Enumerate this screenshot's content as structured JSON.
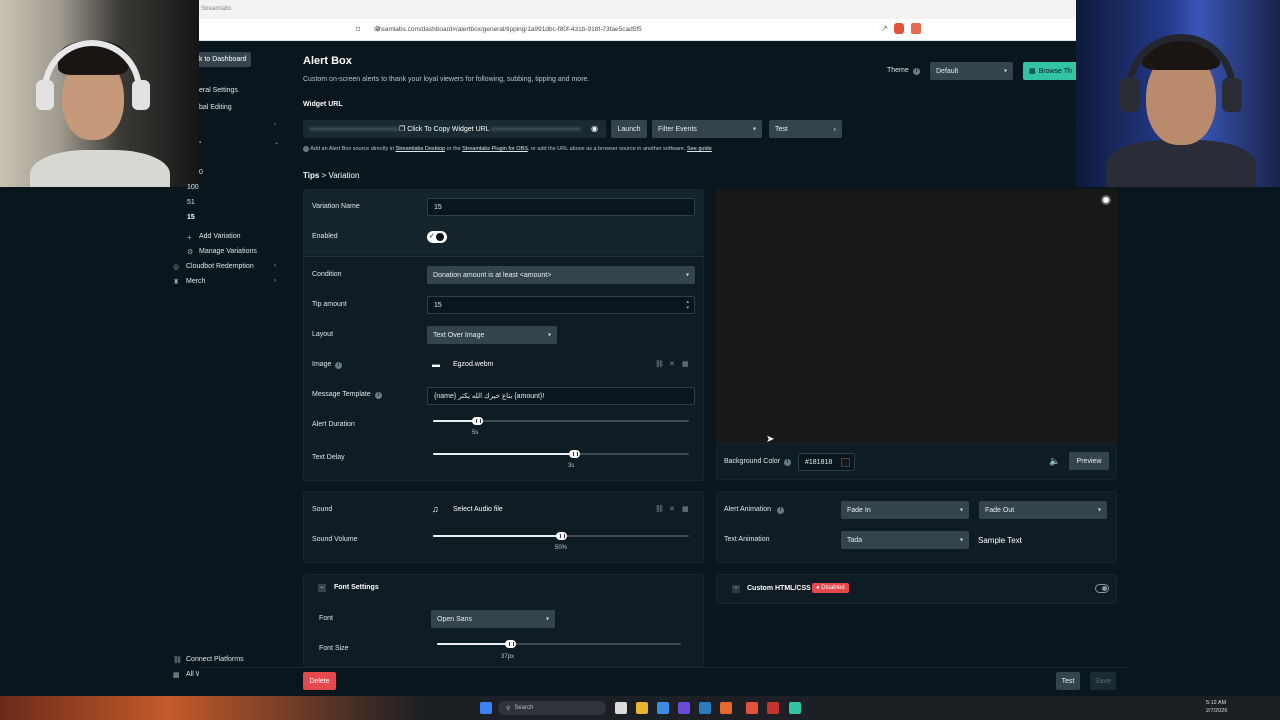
{
  "browser": {
    "tab_title": "Streamlabs",
    "url": "streamlabs.com/dashboard#/alertbox/general/tipping/1a991dbc-f80f-431b-918f-73fae5cad5f5"
  },
  "sidebar": {
    "back_label": "k to Dashboard",
    "general_settings": "eral Settings",
    "global_editing": "bal Editing",
    "variations": [
      "0",
      "100",
      "51",
      "15"
    ],
    "add_variation": "Add Variation",
    "manage_variations": "Manage Variations",
    "cloudbot": "Cloudbot Redemption",
    "merch": "Merch",
    "connect_platforms": "Connect Platforms",
    "all_widgets": "All Widgets"
  },
  "header": {
    "title": "Alert Box",
    "subtitle": "Custom on-screen alerts to thank your loyal viewers for following, subbing, tipping and more.",
    "theme_label": "Theme",
    "theme_value": "Default",
    "browse_button": "Browse Th"
  },
  "widget_url": {
    "label": "Widget URL",
    "copy_label": "Click To Copy Widget URL",
    "launch": "Launch",
    "filter_events": "Filter Events",
    "test": "Test",
    "help_text_1": "Add an Alert Box source directly in",
    "link_desktop": "Streamlabs Desktop",
    "help_text_2": "or the",
    "link_plugin": "Streamlabs Plugin for OBS",
    "help_text_3": ", or add the URL above as a browser source in another software.",
    "link_guide": "See guide"
  },
  "breadcrumb": {
    "parent": "Tips",
    "sep": ">",
    "current": "Variation"
  },
  "form": {
    "variation_name_label": "Variation Name",
    "variation_name_value": "15",
    "enabled_label": "Enabled",
    "condition_label": "Condition",
    "condition_value": "Donation amount is at least <amount>",
    "tip_amount_label": "Tip amount",
    "tip_amount_value": "15",
    "layout_label": "Layout",
    "layout_value": "Text Over Image",
    "image_label": "Image",
    "image_value": "Egzod.webm",
    "message_template_label": "Message Template",
    "message_template_value": "{name} بتاع خيرك الله يكثر {amount}!",
    "alert_duration_label": "Alert Duration",
    "alert_duration_value": "5s",
    "alert_duration_fraction": 0.17,
    "text_delay_label": "Text Delay",
    "text_delay_value": "3s",
    "text_delay_fraction": 0.55,
    "sound_label": "Sound",
    "sound_value": "Select Audio file",
    "sound_volume_label": "Sound Volume",
    "sound_volume_value": "50%",
    "sound_volume_fraction": 0.5,
    "font_settings_label": "Font Settings",
    "font_label": "Font",
    "font_value": "Open Sans",
    "font_size_label": "Font Size",
    "font_size_value": "37px",
    "font_size_fraction": 0.3
  },
  "preview": {
    "bg_color_label": "Background Color",
    "bg_color_value": "#181818",
    "bg_color_hex": "#181818",
    "preview_button": "Preview",
    "alert_animation_label": "Alert Animation",
    "alert_in": "Fade In",
    "alert_out": "Fade Out",
    "text_animation_label": "Text Animation",
    "text_anim_value": "Tada",
    "sample_text": "Sample Text",
    "custom_html_label": "Custom HTML/CSS",
    "disabled_badge": "● Disabled"
  },
  "footer": {
    "delete": "Delete",
    "test": "Test",
    "save": "Save"
  },
  "taskbar": {
    "search_placeholder": "Search",
    "time": "5:12 AM",
    "date": "2/7/2026"
  },
  "colors": {
    "accent_green": "#31c3a2",
    "danger_red": "#e5484d",
    "bg": "#09161d"
  }
}
